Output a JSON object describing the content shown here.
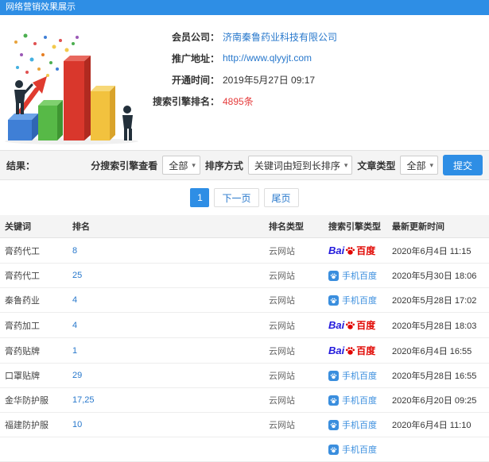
{
  "colors": {
    "accent-blue": "#2e8ee5",
    "link-blue": "#2878cc",
    "highlight-red": "#e53b3b",
    "baidu-blue": "#2319dc",
    "baidu-red": "#e10601",
    "mobile-blue": "#3a8ede"
  },
  "header": {
    "title": "网络营销效果展示"
  },
  "profile": {
    "company_label": "会员公司：",
    "company_value": "济南秦鲁药业科技有限公司",
    "site_label": "推广地址：",
    "site_value": "http://www.qlyyjt.com",
    "opened_label": "开通时间：",
    "opened_value": "2019年5月27日 09:17",
    "ranking_label": "搜索引擎排名：",
    "ranking_value": "4895条"
  },
  "filters": {
    "section_label": "结果：",
    "engine_label": "分搜索引擎查看",
    "engine_value": "全部",
    "sort_label": "排序方式",
    "sort_value": "关键词由短到长排序",
    "type_label": "文章类型",
    "type_value": "全部",
    "submit_label": "提交",
    "chevron": "▾"
  },
  "pagination": {
    "current_page": "1",
    "next_label": "下一页",
    "last_label": "尾页"
  },
  "table": {
    "headers": {
      "keyword": "关键词",
      "rank": "排名",
      "rank_type": "排名类型",
      "engine": "搜索引擎类型",
      "updated": "最新更新时间"
    },
    "rows": [
      {
        "keyword": "膏药代工",
        "rank": "8",
        "rank_type": "云网站",
        "engine": "baidu",
        "updated": "2020年6月4日 11:15"
      },
      {
        "keyword": "膏药代工",
        "rank": "25",
        "rank_type": "云网站",
        "engine": "mobile",
        "updated": "2020年5月30日 18:06"
      },
      {
        "keyword": "秦鲁药业",
        "rank": "4",
        "rank_type": "云网站",
        "engine": "mobile",
        "updated": "2020年5月28日 17:02"
      },
      {
        "keyword": "膏药加工",
        "rank": "4",
        "rank_type": "云网站",
        "engine": "baidu",
        "updated": "2020年5月28日 18:03"
      },
      {
        "keyword": "膏药贴牌",
        "rank": "1",
        "rank_type": "云网站",
        "engine": "baidu",
        "updated": "2020年6月4日 16:55"
      },
      {
        "keyword": "口罩贴牌",
        "rank": "29",
        "rank_type": "云网站",
        "engine": "mobile",
        "updated": "2020年5月28日 16:55"
      },
      {
        "keyword": "金华防护服",
        "rank": "17,25",
        "rank_type": "云网站",
        "engine": "mobile",
        "updated": "2020年6月20日 09:25"
      },
      {
        "keyword": "福建防护服",
        "rank": "10",
        "rank_type": "云网站",
        "engine": "mobile",
        "updated": "2020年6月4日 11:10"
      },
      {
        "keyword": "",
        "rank": "",
        "rank_type": "",
        "engine": "mobile",
        "updated": ""
      }
    ]
  },
  "engines": {
    "baidu": {
      "prefix": "Bai",
      "name": "百度"
    },
    "mobile": {
      "label": "手机百度"
    }
  }
}
